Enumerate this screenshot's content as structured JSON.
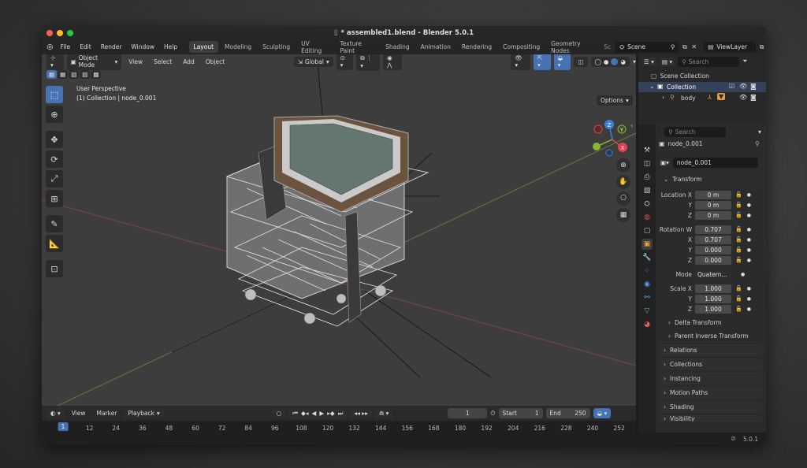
{
  "window": {
    "title": "* assembled1.blend - Blender 5.0.1"
  },
  "menus": [
    "File",
    "Edit",
    "Render",
    "Window",
    "Help"
  ],
  "workspaces": [
    "Layout",
    "Modeling",
    "Sculpting",
    "UV Editing",
    "Texture Paint",
    "Shading",
    "Animation",
    "Rendering",
    "Compositing",
    "Geometry Nodes",
    "Sc"
  ],
  "active_workspace": "Layout",
  "scene": {
    "label": "Scene"
  },
  "viewlayer": {
    "label": "ViewLayer"
  },
  "viewport": {
    "mode": "Object Mode",
    "menu_view": "View",
    "menu_select": "Select",
    "menu_add": "Add",
    "menu_object": "Object",
    "transform_orientation": "Global",
    "options_label": "Options",
    "info_line1": "User Perspective",
    "info_line2": "(1) Collection | node_0.001",
    "gizmo_z": "Z",
    "gizmo_y": "Y",
    "gizmo_x": "X"
  },
  "outliner": {
    "search_placeholder": "Search",
    "scene_collection": "Scene Collection",
    "collection": "Collection",
    "body": "body"
  },
  "properties": {
    "search_placeholder": "Search",
    "object_name": "node_0.001",
    "data_name": "node_0.001",
    "transform_label": "Transform",
    "location_label": "Location X",
    "y_label": "Y",
    "z_label": "Z",
    "x_label": "X",
    "rotation_label": "Rotation W",
    "location": [
      "0 m",
      "0 m",
      "0 m"
    ],
    "rotation": [
      "0.707",
      "0.707",
      "0.000",
      "0.000"
    ],
    "mode_label": "Mode",
    "mode_value": "Quatern...",
    "scale_label": "Scale X",
    "scale": [
      "1.000",
      "1.000",
      "1.000"
    ],
    "delta_transform": "Delta Transform",
    "parent_inverse": "Parent Inverse Transform",
    "sections": [
      "Relations",
      "Collections",
      "Instancing",
      "Motion Paths",
      "Shading",
      "Visibility"
    ]
  },
  "timeline": {
    "menu_view": "View",
    "menu_marker": "Marker",
    "menu_playback": "Playback",
    "current_frame": "1",
    "start_label": "Start",
    "start_value": "1",
    "end_label": "End",
    "end_value": "250",
    "ticks": [
      "1",
      "12",
      "24",
      "36",
      "48",
      "60",
      "72",
      "84",
      "96",
      "108",
      "120",
      "132",
      "144",
      "156",
      "168",
      "180",
      "192",
      "204",
      "216",
      "228",
      "240",
      "252"
    ]
  },
  "status": {
    "version": "5.0.1"
  },
  "colors": {
    "accent": "#4772b3",
    "x_axis": "#e0434f",
    "y_axis": "#8ab535",
    "z_axis": "#3f7fdc"
  }
}
